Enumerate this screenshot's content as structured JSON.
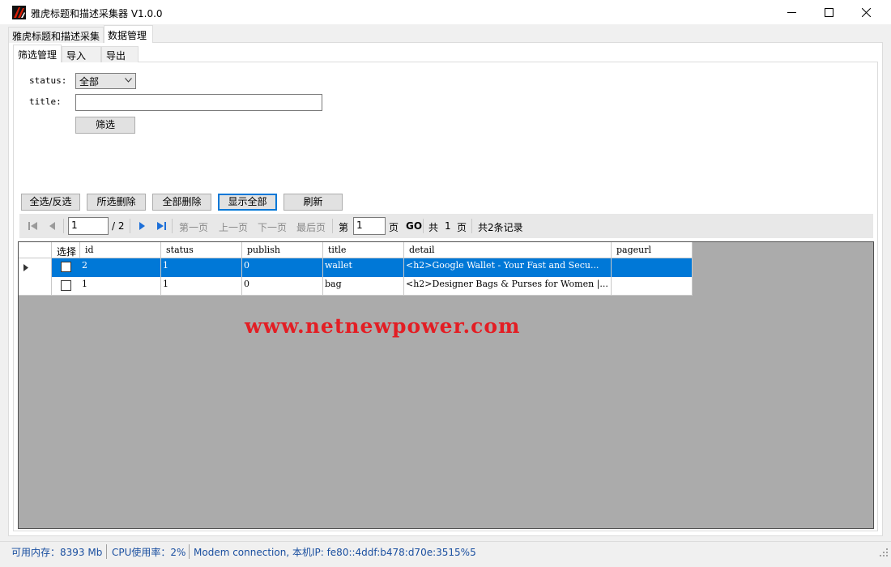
{
  "window": {
    "title": "雅虎标题和描述采集器 V1.0.0"
  },
  "main_tabs": [
    {
      "label": "雅虎标题和描述采集"
    },
    {
      "label": "数据管理"
    }
  ],
  "sub_tabs": [
    {
      "label": "筛选管理"
    },
    {
      "label": "导入"
    },
    {
      "label": "导出"
    }
  ],
  "filter": {
    "status_label": "status:",
    "status_value": "全部",
    "title_label": "title:",
    "title_value": "",
    "filter_button": "筛选"
  },
  "actions": [
    {
      "label": "全选/反选"
    },
    {
      "label": "所选删除"
    },
    {
      "label": "全部删除"
    },
    {
      "label": "显示全部"
    },
    {
      "label": "刷新"
    }
  ],
  "pager": {
    "current_page": "1",
    "total_pages_text": "/ 2",
    "first_page": "第一页",
    "prev_page": "上一页",
    "next_page": "下一页",
    "last_page": "最后页",
    "goto_prefix": "第",
    "goto_value": "1",
    "goto_suffix": "页",
    "go_label": "GO",
    "total_prefix": "共",
    "total_pages": "1",
    "total_suffix": "页",
    "records": "共2条记录"
  },
  "table": {
    "columns": [
      "选择",
      "id",
      "status",
      "publish",
      "title",
      "detail",
      "pageurl"
    ],
    "rows": [
      {
        "id": "2",
        "status": "1",
        "publish": "0",
        "title": "wallet",
        "detail": "<h2>Google Wallet - Your Fast and Secu...",
        "pageurl": ""
      },
      {
        "id": "1",
        "status": "1",
        "publish": "0",
        "title": "bag",
        "detail": "<h2>Designer Bags & Purses for Women |...",
        "pageurl": ""
      }
    ]
  },
  "watermark": "www.netnewpower.com",
  "status_bar": {
    "memory": "可用内存：8393 Mb",
    "cpu": "CPU使用率：2%",
    "network": "Modem connection,  本机IP: fe80::4ddf:b478:d70e:3515%5"
  },
  "colors": {
    "selection": "#0078d7",
    "watermark": "#e31e24",
    "status_text": "#1a4fa0"
  }
}
